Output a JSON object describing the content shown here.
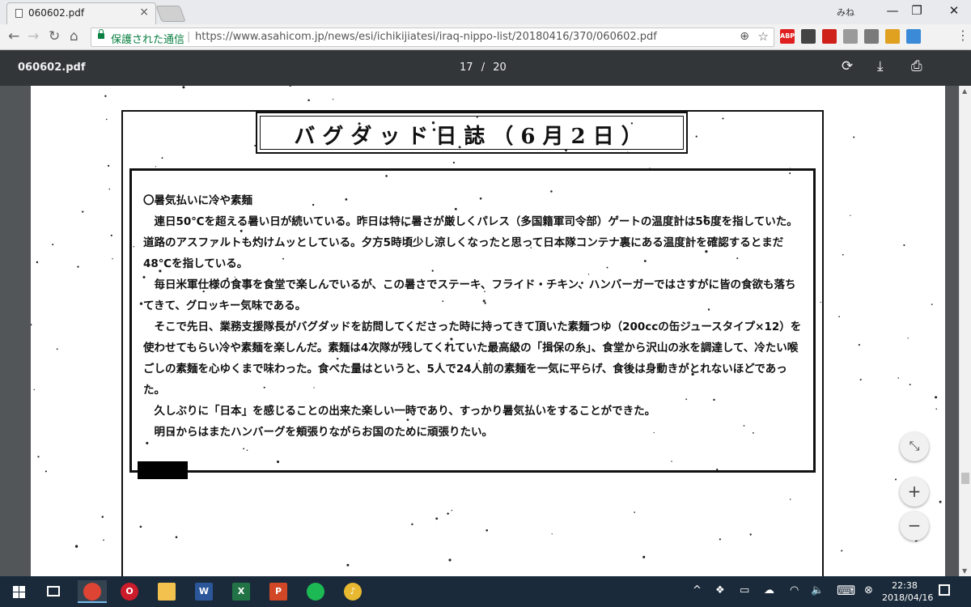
{
  "browser": {
    "tab_title": "060602.pdf",
    "tab_close": "×",
    "user_label": "みね",
    "window_controls": {
      "minimize": "—",
      "maximize": "❐",
      "close": "✕"
    },
    "nav": {
      "back": "←",
      "forward": "→",
      "reload": "↻",
      "home": "⌂"
    },
    "secure_label": "保護された通信",
    "url_separator": "|",
    "url": "https://www.asahicom.jp/news/esi/ichikijiatesi/iraq-nippo-list/20180416/370/060602.pdf",
    "extensions": [
      {
        "name": "adblock-plus-icon",
        "text": "ABP",
        "color": "#e02020"
      },
      {
        "name": "extension-icon",
        "text": "",
        "color": "#444444"
      },
      {
        "name": "acrobat-icon",
        "text": "",
        "color": "#d0201a"
      },
      {
        "name": "extension-icon",
        "text": "",
        "color": "#9a9a9a"
      },
      {
        "name": "extension-icon",
        "text": "",
        "color": "#7a7a7a"
      },
      {
        "name": "extension-icon",
        "text": "",
        "color": "#e0a020"
      },
      {
        "name": "download-extension-icon",
        "text": "",
        "color": "#3a8ad8"
      }
    ],
    "menu": "⋮"
  },
  "pdf_viewer": {
    "file_name": "060602.pdf",
    "current_page": "17",
    "page_separator": "/",
    "total_pages": "20",
    "icons": {
      "rotate": "⟳",
      "download": "⤓",
      "print": "⎙"
    },
    "zoom": {
      "fit": "⤡",
      "in": "+",
      "out": "−"
    }
  },
  "document": {
    "title": "バグダッド日誌（6月2日）",
    "heading": "〇暑気払いに冷や素麺",
    "paragraphs": [
      "連日50℃を超える暑い日が続いている。昨日は特に暑さが厳しくパレス（多国籍軍司令部）ゲートの温度計は56度を指していた。道路のアスファルトも灼けムッとしている。夕方5時頃少し涼しくなったと思って日本隊コンテナ裏にある温度計を確認するとまだ48℃を指している。",
      "毎日米軍仕様の食事を食堂で楽しんでいるが、この暑さでステーキ、フライド・チキン、ハンバーガーではさすがに皆の食欲も落ちてきて、グロッキー気味である。",
      "そこで先日、業務支援隊長がバグダッドを訪問してくださった時に持ってきて頂いた素麺つゆ（200ccの缶ジュースタイプ×12）を使わせてもらい冷や素麺を楽しんだ。素麺は4次隊が残してくれていた最高級の「揖保の糸」、食堂から沢山の氷を調達して、冷たい喉ごしの素麺を心ゆくまで味わった。食べた量はというと、5人で24人前の素麺を一気に平らげ、食後は身動きがとれないほどであった。",
      "久しぶりに「日本」を感じることの出来た楽しい一時であり、すっかり暑気払いをすることができた。",
      "明日からはまたハンバーグを頬張りながらお国のために頑張りたい。"
    ]
  },
  "taskbar": {
    "apps": [
      {
        "name": "chrome-app",
        "label": "",
        "color": "#dd4433",
        "active": true
      },
      {
        "name": "opera-app",
        "label": "O",
        "color": "#cc1b2b",
        "active": false
      },
      {
        "name": "file-explorer-app",
        "label": "",
        "color": "#f2c14e",
        "active": false
      },
      {
        "name": "word-app",
        "label": "W",
        "color": "#2b579a",
        "active": false
      },
      {
        "name": "excel-app",
        "label": "X",
        "color": "#217346",
        "active": false
      },
      {
        "name": "powerpoint-app",
        "label": "P",
        "color": "#d24726",
        "active": false
      },
      {
        "name": "spotify-app",
        "label": "",
        "color": "#1db954",
        "active": false
      },
      {
        "name": "itunes-app",
        "label": "♪",
        "color": "#e8b830",
        "active": false
      }
    ],
    "tray": {
      "chevron": "^",
      "dropbox": "❖",
      "battery": "▭",
      "cloud": "☁",
      "wifi": "◠",
      "volume": "🔈",
      "keyboard": "⌨",
      "close": "⊗"
    },
    "time": "22:38",
    "date": "2018/04/16"
  }
}
